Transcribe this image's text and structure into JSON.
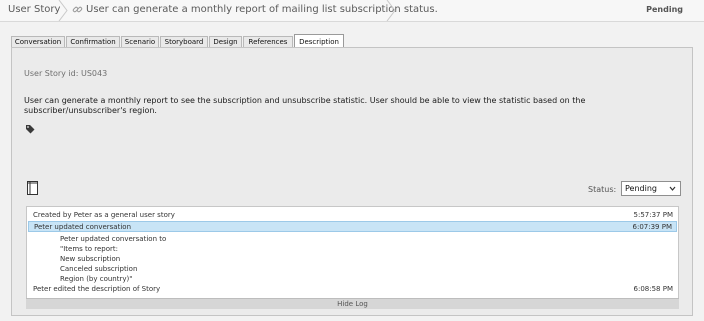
{
  "header": {
    "breadcrumb_root": "User Story",
    "breadcrumb_title": "User can generate a monthly report of mailing list subscription status.",
    "status": "Pending"
  },
  "tabs": [
    {
      "label": "Conversation"
    },
    {
      "label": "Confirmation"
    },
    {
      "label": "Scenario"
    },
    {
      "label": "Storyboard"
    },
    {
      "label": "Design"
    },
    {
      "label": "References"
    },
    {
      "label": "Description",
      "active": true
    }
  ],
  "story": {
    "id_label": "User Story id:  US043",
    "description": "User can generate a monthly report to see the subscription and unsubscribe statistic. User should be able to view the statistic based on the subscriber/unsubscriber's region."
  },
  "status_field": {
    "label": "Status:",
    "value": "Pending"
  },
  "log": {
    "entries": [
      {
        "message": "Created by Peter as a general user story",
        "time": "5:57:37 PM"
      },
      {
        "message": "Peter updated conversation",
        "time": "6:07:39 PM",
        "selected": true
      },
      {
        "message": "Peter edited the description of Story",
        "time": "6:08:58 PM"
      }
    ],
    "detail_lines": [
      "Peter updated conversation to",
      "\"Items to report:",
      "New subscription",
      "Canceled subscription",
      "Region (by country)\""
    ],
    "hide_label": "Hide Log"
  },
  "icons": {
    "breadcrumb_link": "link-icon",
    "tag": "tag-icon",
    "document": "document-icon",
    "dropdown": "chevron-down-icon"
  },
  "colors": {
    "selected_row": "#c8e4f6",
    "panel_bg": "#ebebeb"
  }
}
